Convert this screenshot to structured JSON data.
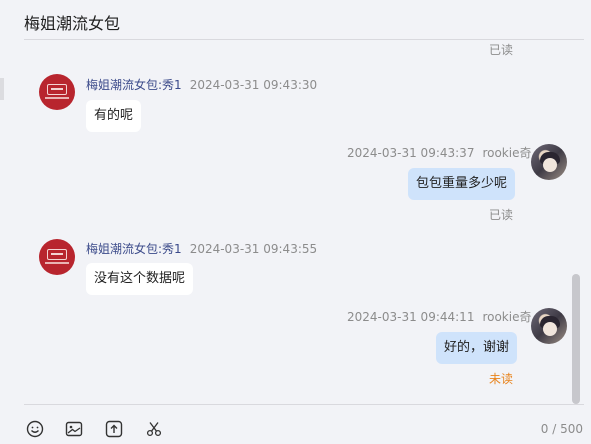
{
  "header": {
    "title": "梅姐潮流女包"
  },
  "messages": [
    {
      "id": "status0",
      "status": "已读"
    },
    {
      "id": "m1",
      "sender": "梅姐潮流女包:秀1",
      "time": "2024-03-31 09:43:30",
      "text": "有的呢"
    },
    {
      "id": "m2",
      "sender": "rookie奇",
      "time": "2024-03-31 09:43:37",
      "text": "包包重量多少呢",
      "status": "已读"
    },
    {
      "id": "m3",
      "sender": "梅姐潮流女包:秀1",
      "time": "2024-03-31 09:43:55",
      "text": "没有这个数据呢"
    },
    {
      "id": "m4",
      "sender": "rookie奇",
      "time": "2024-03-31 09:44:11",
      "text": "好的，谢谢",
      "status": "未读"
    }
  ],
  "colors": {
    "unread": "#e8831c",
    "outgoing_bubble": "#cfe3fb",
    "shop_avatar": "#b8252e"
  },
  "toolbar": {
    "icons": [
      "emoji-icon",
      "image-icon",
      "upload-icon",
      "scissors-icon"
    ],
    "counter": "0 / 500"
  }
}
